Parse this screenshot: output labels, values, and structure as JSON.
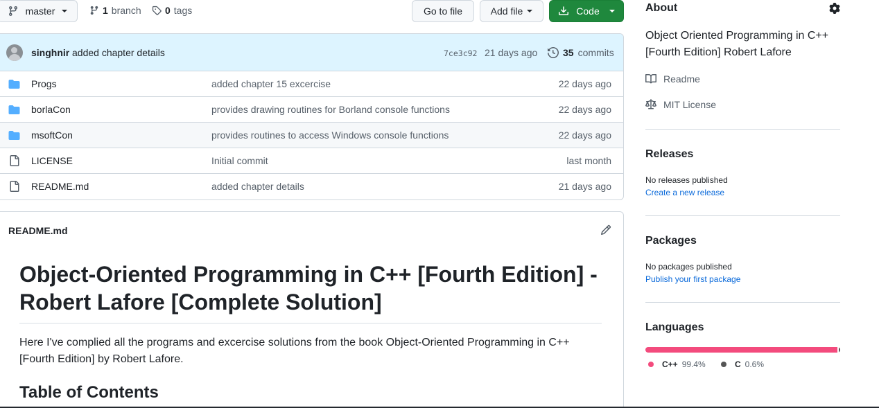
{
  "toolbar": {
    "branch_name": "master",
    "branch_count": "1",
    "branch_label": "branch",
    "tag_count": "0",
    "tag_label": "tags",
    "goto_file": "Go to file",
    "add_file": "Add file",
    "code": "Code"
  },
  "latest_commit": {
    "user": "singhnir",
    "message": "added chapter details",
    "sha": "7ce3c92",
    "age": "21 days ago",
    "count": "35",
    "count_label": "commits"
  },
  "files": [
    {
      "name": "Progs",
      "type": "folder",
      "message": "added chapter 15 excercise",
      "age": "22 days ago"
    },
    {
      "name": "borlaCon",
      "type": "folder",
      "message": "provides drawing routines for Borland console functions",
      "age": "22 days ago"
    },
    {
      "name": "msoftCon",
      "type": "folder",
      "message": "provides routines to access Windows console functions",
      "age": "22 days ago"
    },
    {
      "name": "LICENSE",
      "type": "file",
      "message": "Initial commit",
      "age": "last month"
    },
    {
      "name": "README.md",
      "type": "file",
      "message": "added chapter details",
      "age": "21 days ago"
    }
  ],
  "readme": {
    "filename": "README.md",
    "heading": "Object-Oriented Programming in C++ [Fourth Edition] - Robert Lafore [Complete Solution]",
    "paragraph": "Here I've complied all the programs and excercise solutions from the book Object-Oriented Programming in C++ [Fourth Edition] by Robert Lafore.",
    "toc": "Table of Contents"
  },
  "about": {
    "title": "About",
    "description": "Object Oriented Programming in C++ [Fourth Edition] Robert Lafore",
    "readme_link": "Readme",
    "license_link": "MIT License"
  },
  "releases": {
    "title": "Releases",
    "empty": "No releases published",
    "create": "Create a new release"
  },
  "packages": {
    "title": "Packages",
    "empty": "No packages published",
    "publish": "Publish your first package"
  },
  "languages": {
    "title": "Languages",
    "items": [
      {
        "name": "C++",
        "percent": "99.4%",
        "share": 99.4,
        "color": "#f34b7d"
      },
      {
        "name": "C",
        "percent": "0.6%",
        "share": 0.6,
        "color": "#555555"
      }
    ]
  },
  "colors": {
    "accent_green": "#1f883d",
    "commit_bar_bg": "#ddf4ff",
    "folder_blue": "#54aeff",
    "link_blue": "#0969da"
  }
}
